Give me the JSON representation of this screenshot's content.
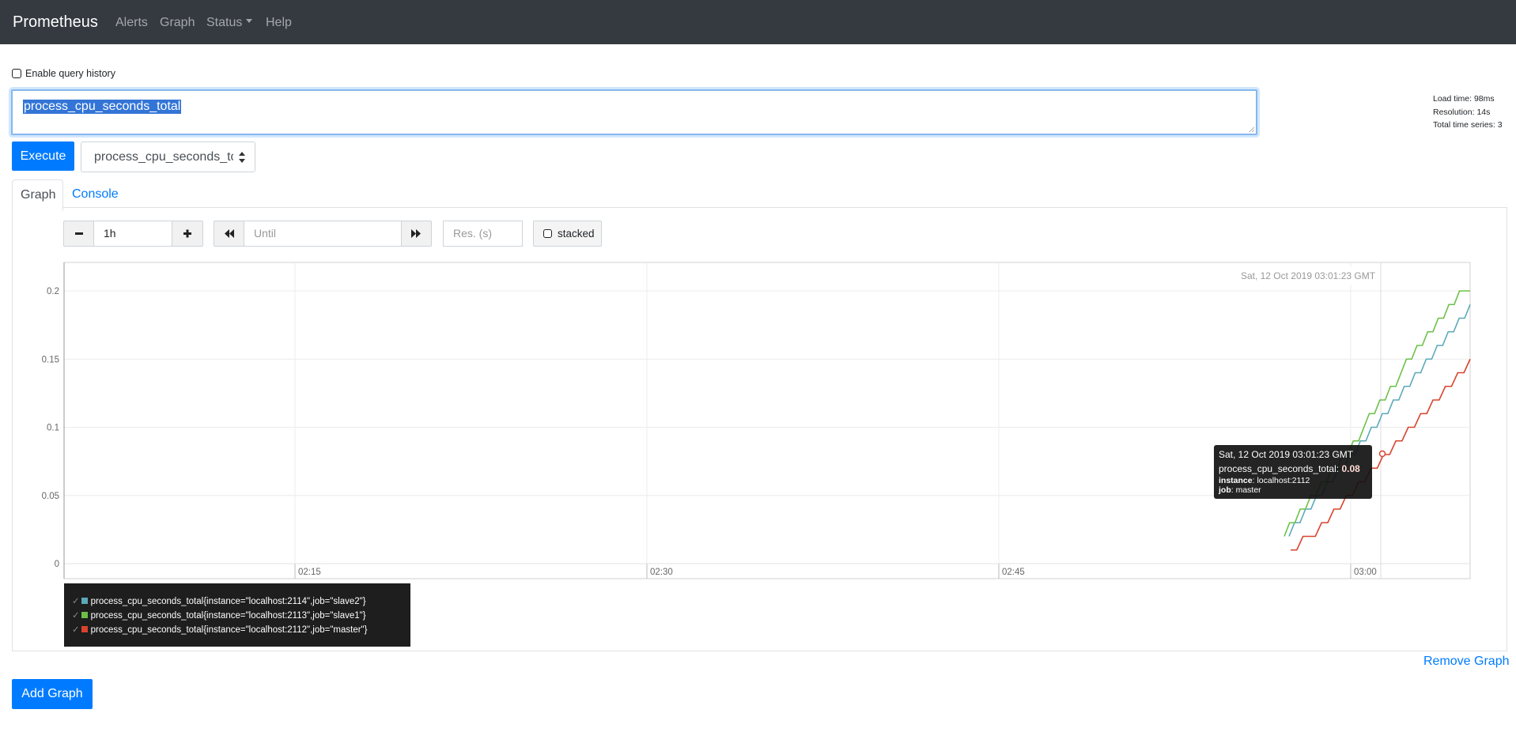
{
  "navbar": {
    "brand": "Prometheus",
    "items": [
      "Alerts",
      "Graph",
      "Status",
      "Help"
    ]
  },
  "history": {
    "label": "Enable query history",
    "checked": false
  },
  "expression": {
    "value": "process_cpu_seconds_total"
  },
  "stats": {
    "load_time": "Load time: 98ms",
    "resolution": "Resolution: 14s",
    "total_series": "Total time series: 3"
  },
  "execute_label": "Execute",
  "metric_select": {
    "value": "process_cpu_seconds_total"
  },
  "tabs": {
    "graph": "Graph",
    "console": "Console"
  },
  "controls": {
    "range": "1h",
    "until_placeholder": "Until",
    "res_placeholder": "Res. (s)",
    "stacked_label": "stacked"
  },
  "chart_data": {
    "type": "line",
    "y_ticks": [
      "0.2",
      "0.15",
      "0.1",
      "0.05",
      "0"
    ],
    "x_ticks": [
      "02:15",
      "02:30",
      "02:45",
      "03:00"
    ],
    "ylim": [
      -0.01,
      0.22
    ],
    "hover_label": "Sat, 12 Oct 2019 03:01:23 GMT",
    "series": [
      {
        "name": "process_cpu_seconds_total{instance=\"localhost:2114\",job=\"slave2\"}",
        "color": "#5ba8b8",
        "values": [
          0.02,
          0.03,
          0.03,
          0.04,
          0.04,
          0.05,
          0.05,
          0.06,
          0.06,
          0.07,
          0.07,
          0.08,
          0.08,
          0.09,
          0.09,
          0.1,
          0.1,
          0.11,
          0.11,
          0.12,
          0.12,
          0.13,
          0.13,
          0.14,
          0.14,
          0.15,
          0.15,
          0.16,
          0.16,
          0.17,
          0.17,
          0.18,
          0.18,
          0.19
        ]
      },
      {
        "name": "process_cpu_seconds_total{instance=\"localhost:2113\",job=\"slave1\"}",
        "color": "#6bc047",
        "values": [
          0.02,
          0.03,
          0.03,
          0.04,
          0.04,
          0.05,
          0.05,
          0.06,
          0.06,
          0.07,
          0.07,
          0.08,
          0.08,
          0.09,
          0.09,
          0.1,
          0.11,
          0.11,
          0.12,
          0.12,
          0.13,
          0.13,
          0.14,
          0.15,
          0.15,
          0.16,
          0.16,
          0.17,
          0.17,
          0.18,
          0.18,
          0.19,
          0.19,
          0.2,
          0.2,
          0.2
        ]
      },
      {
        "name": "process_cpu_seconds_total{instance=\"localhost:2112\",job=\"master\"}",
        "color": "#d8432e",
        "values": [
          0.01,
          0.01,
          0.02,
          0.02,
          0.02,
          0.03,
          0.03,
          0.04,
          0.04,
          0.05,
          0.05,
          0.06,
          0.06,
          0.07,
          0.07,
          0.08,
          0.08,
          0.09,
          0.09,
          0.1,
          0.1,
          0.11,
          0.11,
          0.12,
          0.12,
          0.13,
          0.13,
          0.14,
          0.14,
          0.15
        ]
      }
    ]
  },
  "tooltip": {
    "time": "Sat, 12 Oct 2019 03:01:23 GMT",
    "metric": "process_cpu_seconds_total:",
    "value": "0.08",
    "instance_key": "instance",
    "instance_val": ": localhost:2112",
    "job_key": "job",
    "job_val": ": master"
  },
  "remove_graph": "Remove Graph",
  "add_graph": "Add Graph"
}
